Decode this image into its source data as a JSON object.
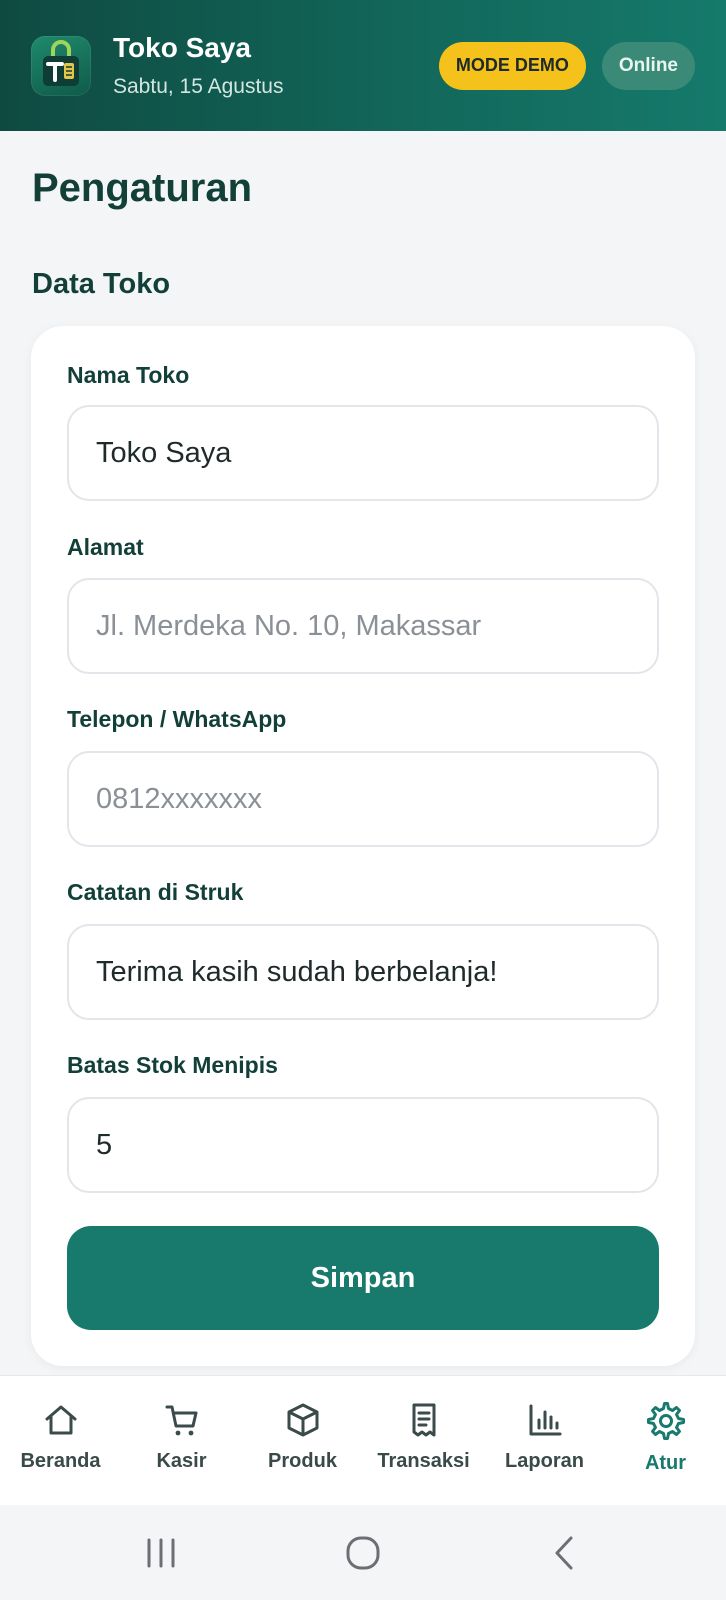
{
  "header": {
    "store_name": "Toko Saya",
    "date": "Sabtu, 15 Agustus",
    "badge_demo": "MODE DEMO",
    "badge_online": "Online",
    "logo_icon": "store-bag-logo",
    "colors": {
      "header_start": "#0f4a41",
      "header_end": "#157a6b",
      "demo_badge": "#f5c21b",
      "online_badge": "#3b8a77"
    }
  },
  "page": {
    "title": "Pengaturan",
    "section_title": "Data Toko"
  },
  "form": {
    "store_name": {
      "label": "Nama Toko",
      "value": "Toko Saya",
      "placeholder": ""
    },
    "address": {
      "label": "Alamat",
      "value": "",
      "placeholder": "Jl. Merdeka No. 10, Makassar"
    },
    "phone": {
      "label": "Telepon / WhatsApp",
      "value": "",
      "placeholder": "0812xxxxxxx"
    },
    "receipt_note": {
      "label": "Catatan di Struk",
      "value": "Terima kasih sudah berbelanja!",
      "placeholder": ""
    },
    "low_stock": {
      "label": "Batas Stok Menipis",
      "value": "5",
      "placeholder": ""
    },
    "save_label": "Simpan",
    "accent": "#177a6c"
  },
  "nav": {
    "items": [
      {
        "label": "Beranda",
        "icon": "home-icon",
        "active": false
      },
      {
        "label": "Kasir",
        "icon": "cart-icon",
        "active": false
      },
      {
        "label": "Produk",
        "icon": "box-icon",
        "active": false
      },
      {
        "label": "Transaksi",
        "icon": "receipt-icon",
        "active": false
      },
      {
        "label": "Laporan",
        "icon": "chart-icon",
        "active": false
      },
      {
        "label": "Atur",
        "icon": "gear-icon",
        "active": true
      }
    ]
  },
  "system": {
    "buttons": [
      "recent-apps-icon",
      "home-circle-icon",
      "back-icon"
    ]
  }
}
